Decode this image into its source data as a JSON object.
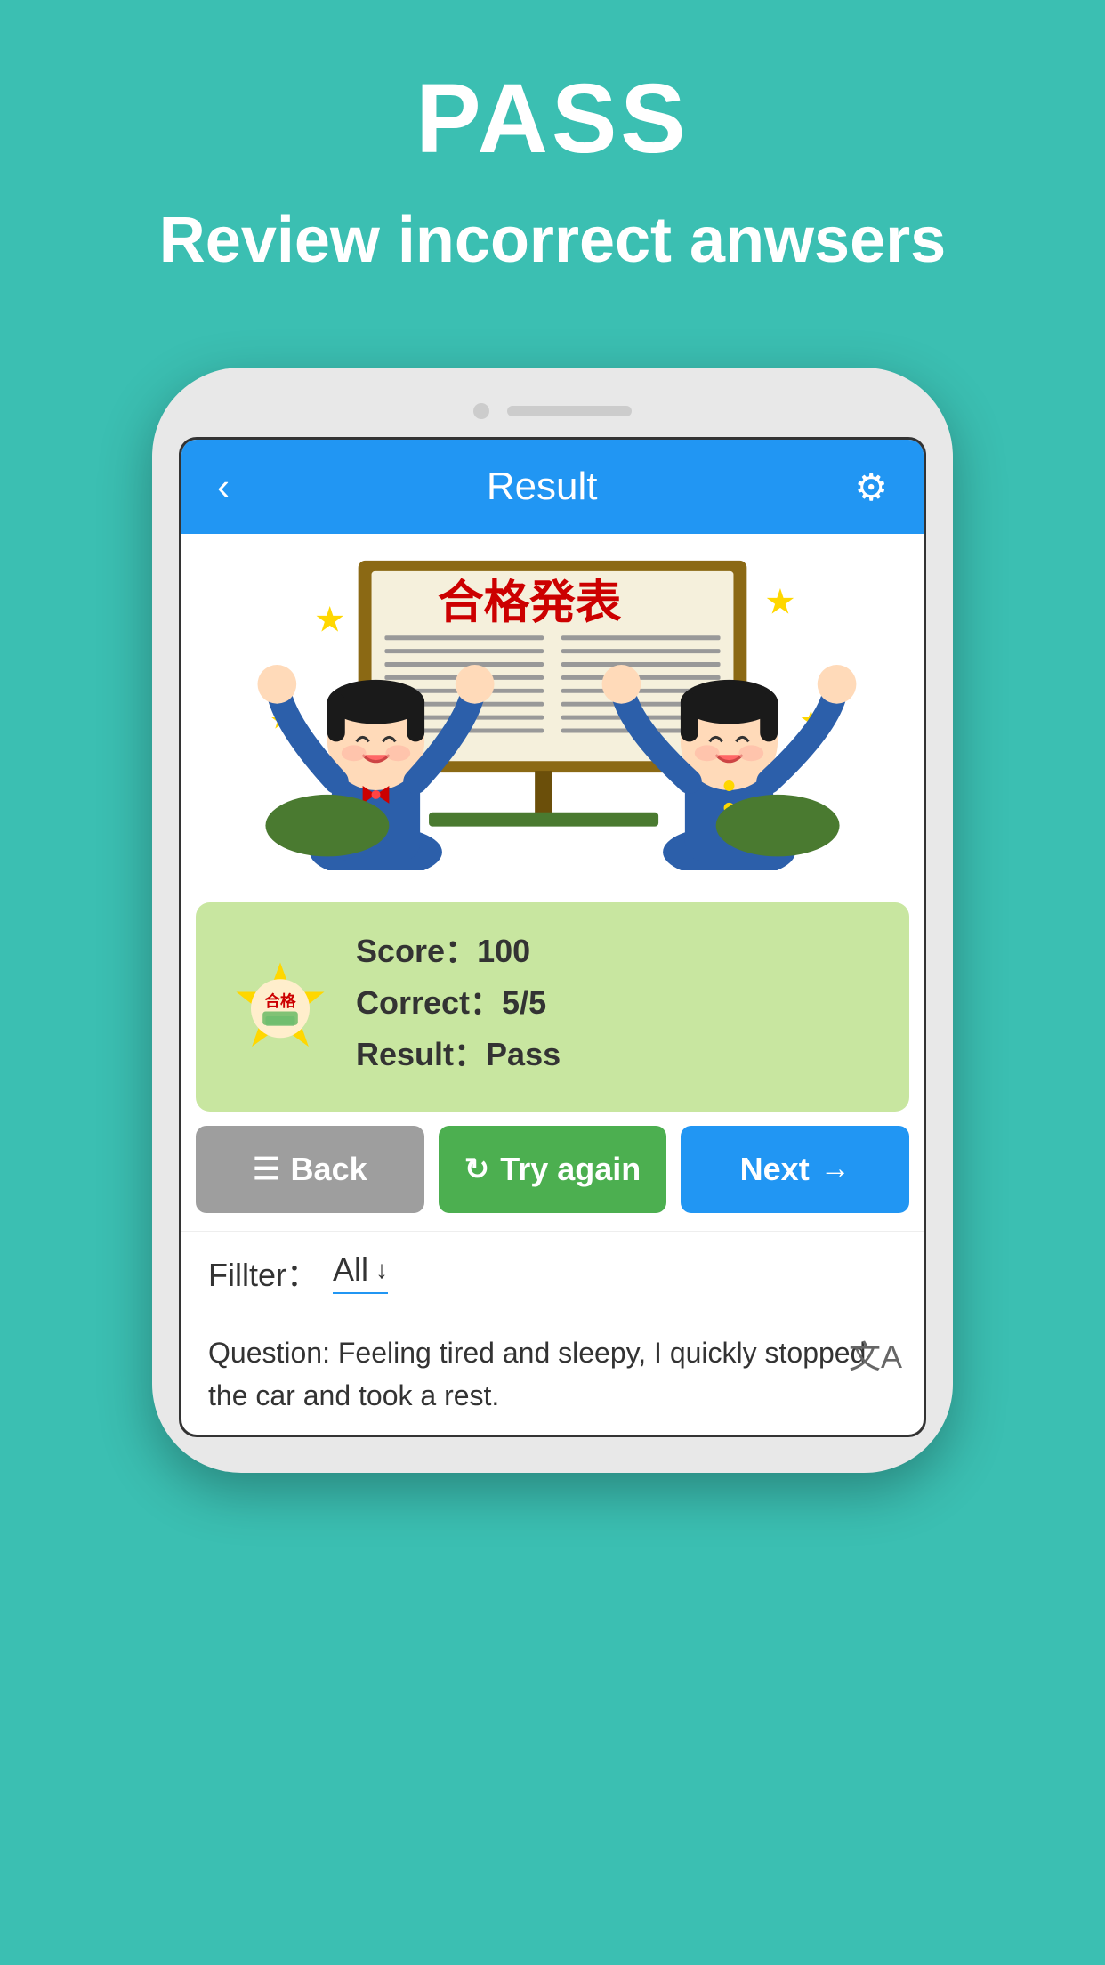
{
  "background_color": "#3BBFB2",
  "header": {
    "pass_label": "PASS",
    "subtitle": "Review incorrect anwsers"
  },
  "app": {
    "header": {
      "title": "Result",
      "back_icon": "‹",
      "settings_icon": "⚙"
    },
    "score_card": {
      "score_label": "Score：",
      "score_value": "100",
      "correct_label": "Correct：",
      "correct_value": "5/5",
      "result_label": "Result：",
      "result_value": "Pass"
    },
    "buttons": {
      "back_label": "Back",
      "try_again_label": "Try again",
      "next_label": "Next"
    },
    "filter": {
      "label": "Fillter：",
      "value": "All",
      "arrow": "↓"
    },
    "question": {
      "text": "Question: Feeling tired and sleepy, I quickly stopped the car and took a rest.",
      "translate_icon": "文A"
    }
  }
}
